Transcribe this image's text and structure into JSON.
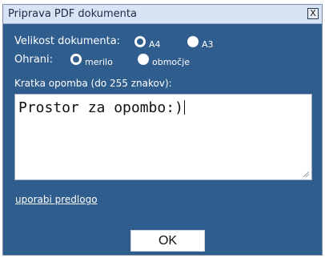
{
  "dialog": {
    "title": "Priprava PDF dokumenta",
    "close_label": "X",
    "size_label": "Velikost dokumenta:",
    "size_options": [
      {
        "label": "A4",
        "checked": true
      },
      {
        "label": "A3",
        "checked": false
      }
    ],
    "keep_label": "Ohrani:",
    "keep_options": [
      {
        "label": "merilo",
        "checked": true
      },
      {
        "label": "območje",
        "checked": false
      }
    ],
    "note_label": "Kratka opomba (do 255 znakov):",
    "note_value": "Prostor za opombo:)",
    "template_link": "uporabi predlogo",
    "ok_label": "OK"
  },
  "colors": {
    "dialog_bg": "#2f5d8e",
    "titlebar_bg": "#d6e4f5"
  }
}
